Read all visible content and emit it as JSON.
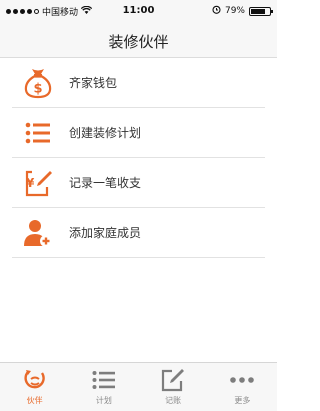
{
  "status_bar": {
    "carrier": "中国移动",
    "time": "11:00",
    "battery": "79%",
    "battery_level": 0.79
  },
  "nav": {
    "title": "装修伙伴"
  },
  "menu": {
    "items": [
      {
        "label": "齐家钱包",
        "icon": "money-bag-icon"
      },
      {
        "label": "创建装修计划",
        "icon": "list-icon"
      },
      {
        "label": "记录一笔收支",
        "icon": "yen-edit-icon"
      },
      {
        "label": "添加家庭成员",
        "icon": "add-member-icon"
      }
    ]
  },
  "tab_bar": {
    "tabs": [
      {
        "label": "伙伴",
        "icon": "partner-icon",
        "active": true
      },
      {
        "label": "计划",
        "icon": "list-icon",
        "active": false
      },
      {
        "label": "记账",
        "icon": "edit-icon",
        "active": false
      },
      {
        "label": "更多",
        "icon": "more-icon",
        "active": false
      }
    ]
  },
  "colors": {
    "accent": "#e8692a",
    "inactive": "#8a8a8a",
    "bar_background": "#f7f7f7"
  }
}
